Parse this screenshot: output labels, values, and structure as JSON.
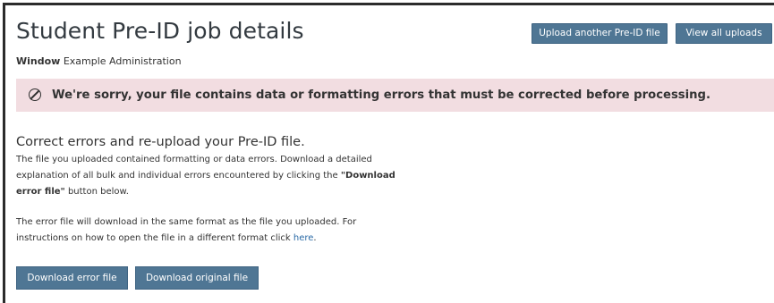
{
  "header": {
    "title": "Student Pre-ID job details",
    "upload_button": "Upload another Pre-ID file",
    "view_button": "View all uploads"
  },
  "window": {
    "label": "Window",
    "value": "Example Administration"
  },
  "banner": {
    "icon": "prohibited-icon",
    "message": "We're sorry, your file contains data or formatting errors that must be corrected before processing.",
    "background": "#f2dde1"
  },
  "content": {
    "heading": "Correct errors and re-upload your Pre-ID file.",
    "para1_lines": [
      "The file you uploaded contained formatting or data errors. Download a detailed",
      "explanation of all bulk and individual errors encountered by clicking the "
    ],
    "para1_bold": "\"Download error file\"",
    "para1_bold_start": "\"Download",
    "para1_bold_end": "error file\"",
    "para1_end": " button below.",
    "para2_line1": "The error file will download in the same format as the file you uploaded. For",
    "para2_line2": "instructions on how to open the file in a different format click ",
    "para2_link": "here",
    "para2_end": "."
  },
  "actions": {
    "download_error": "Download error file",
    "download_original": "Download original file"
  },
  "colors": {
    "button": "#4f7694",
    "link": "#2a6aa6"
  }
}
